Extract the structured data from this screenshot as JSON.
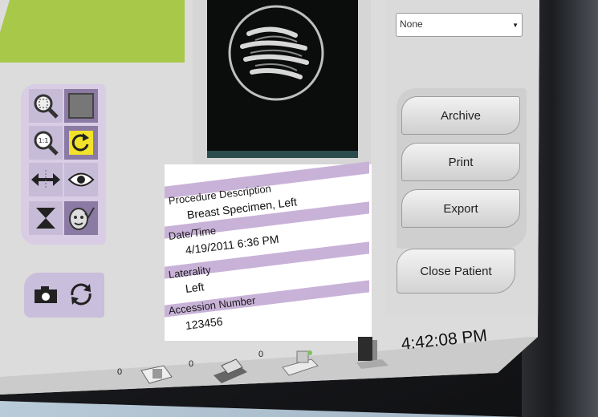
{
  "select": {
    "value": "None"
  },
  "buttons": {
    "archive": "Archive",
    "print": "Print",
    "export": "Export",
    "close_patient": "Close Patient"
  },
  "info": {
    "procedure_label": "Procedure Description",
    "procedure_value": "Breast Specimen, Left",
    "datetime_label": "Date/Time",
    "datetime_value": "4/19/2011 6:36 PM",
    "laterality_label": "Laterality",
    "laterality_value": "Left",
    "accession_label": "Accession Number",
    "accession_value": "123456"
  },
  "taskbar": {
    "count_1": "0",
    "count_2": "0",
    "count_3": "0",
    "clock": "4:42:08 PM"
  },
  "colors": {
    "accent_purple": "#c9b2d8",
    "tool_purple": "#8b7aa3",
    "green_header": "#a8c84a"
  }
}
